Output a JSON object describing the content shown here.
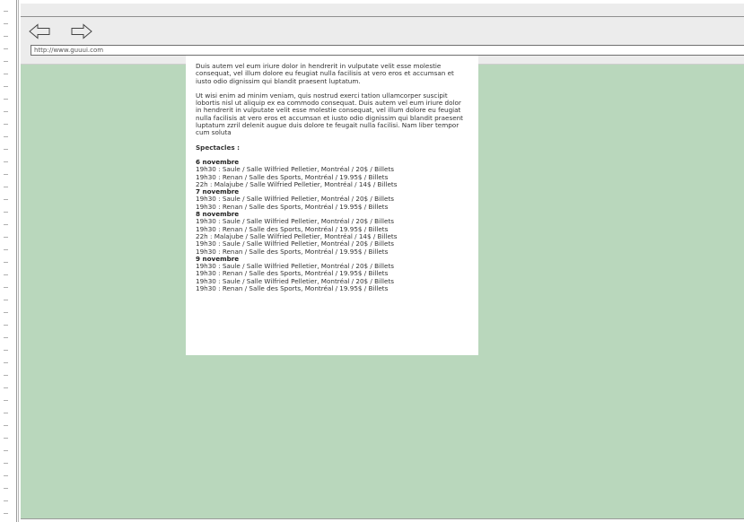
{
  "browser": {
    "url": "http://www.guuui.com",
    "back_icon": "back-arrow-icon",
    "forward_icon": "forward-arrow-icon",
    "background_color": "#b9d7bc"
  },
  "content": {
    "paragraphs": [
      "Duis autem vel eum iriure dolor in hendrerit in vulputate velit esse molestie consequat, vel illum dolore eu feugiat nulla facilisis at vero eros et accumsan et iusto odio dignissim qui blandit praesent luptatum.",
      "Ut wisi enim ad minim veniam, quis nostrud exerci tation ullamcorper suscipit lobortis nisl ut aliquip ex ea commodo consequat. Duis autem vel eum iriure dolor in hendrerit in vulputate velit esse molestie consequat, vel illum dolore eu feugiat nulla facilisis at vero eros et accumsan et iusto odio dignissim qui blandit praesent luptatum zzril delenit augue duis dolore te feugait nulla facilisi. Nam liber tempor cum soluta"
    ],
    "section_title": "Spectacles :",
    "days": [
      {
        "heading": "6 novembre",
        "shows": [
          "19h30 : Saule / Salle Wilfried Pelletier, Montréal / 20$ / Billets",
          "19h30 : Renan / Salle des Sports, Montréal / 19.95$ / Billets",
          "22h : Malajube / Salle Wilfried Pelletier, Montréal / 14$ / Billets"
        ]
      },
      {
        "heading": "7 novembre",
        "shows": [
          "19h30 : Saule / Salle Wilfried Pelletier, Montréal / 20$ / Billets",
          "19h30 : Renan / Salle des Sports, Montréal / 19.95$ / Billets"
        ]
      },
      {
        "heading": "8 novembre",
        "shows": [
          "19h30 : Saule / Salle Wilfried Pelletier, Montréal / 20$ / Billets",
          "19h30 : Renan / Salle des Sports, Montréal / 19.95$ / Billets",
          "22h : Malajube / Salle Wilfried Pelletier, Montréal / 14$ / Billets",
          "19h30 : Saule / Salle Wilfried Pelletier, Montréal / 20$ / Billets",
          "19h30 : Renan / Salle des Sports, Montréal / 19.95$ / Billets"
        ]
      },
      {
        "heading": "9 novembre",
        "shows": [
          "19h30 : Saule / Salle Wilfried Pelletier, Montréal / 20$ / Billets",
          "19h30 : Renan / Salle des Sports, Montréal / 19.95$ / Billets",
          "19h30 : Saule / Salle Wilfried Pelletier, Montréal / 20$ / Billets",
          "19h30 : Renan / Salle des Sports, Montréal / 19.95$ / Billets"
        ]
      }
    ]
  }
}
